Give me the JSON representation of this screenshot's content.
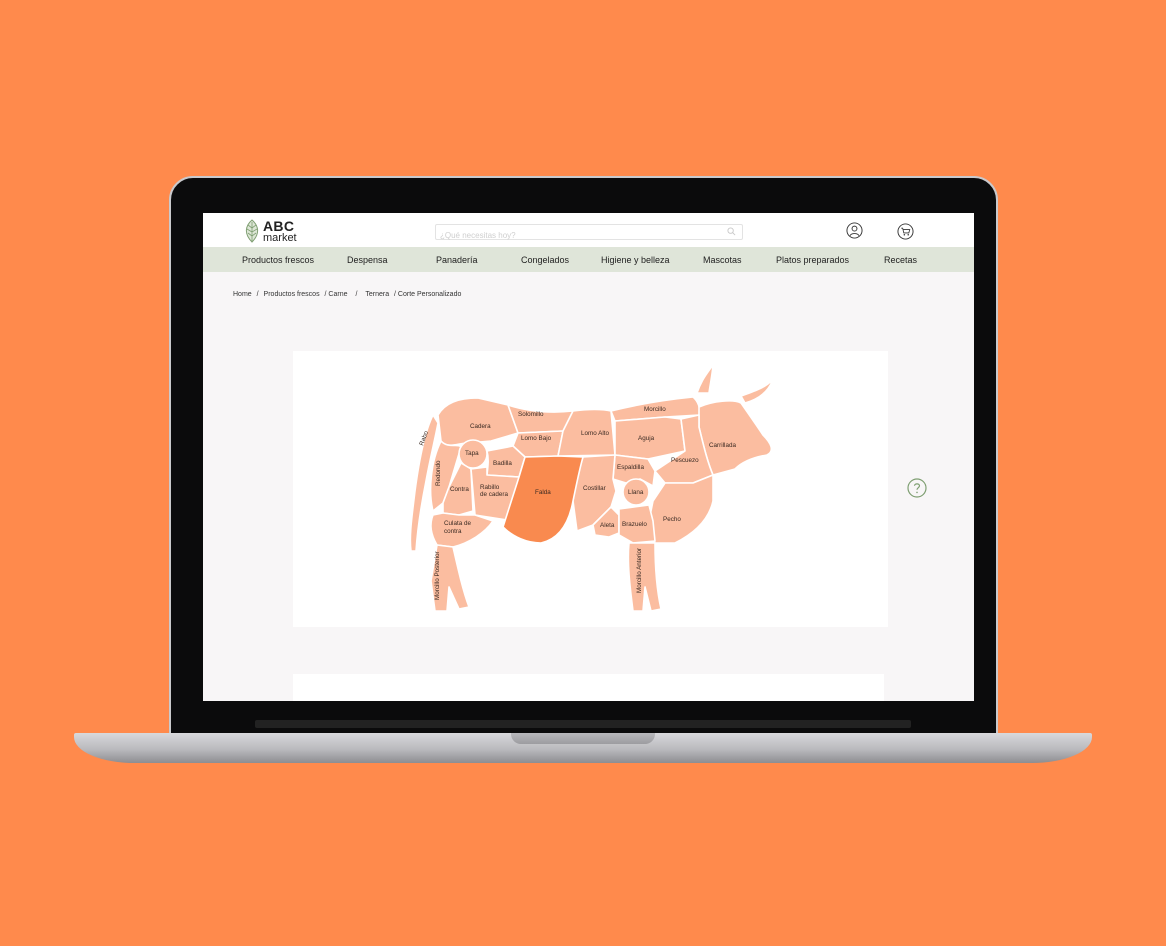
{
  "header": {
    "logo_primary": "ABC",
    "logo_secondary": "market",
    "search_placeholder": "¿Qué necesitas hoy?"
  },
  "nav": {
    "items": [
      {
        "label": "Productos frescos"
      },
      {
        "label": "Despensa"
      },
      {
        "label": "Panadería"
      },
      {
        "label": "Congelados"
      },
      {
        "label": "Higiene y belleza"
      },
      {
        "label": "Mascotas"
      },
      {
        "label": "Platos preparados"
      },
      {
        "label": "Recetas"
      }
    ]
  },
  "breadcrumb": {
    "items": [
      "Home",
      "/",
      "Productos frescos",
      "/ Carne",
      "/",
      "Ternera",
      "/ Corte Personalizado"
    ]
  },
  "cuts": {
    "rabo": "Rabo",
    "cadera": "Cadera",
    "solomillo": "Solomillo",
    "morcillo": "Morcillo",
    "lomo_bajo": "Lomo Bajo",
    "lomo_alto": "Lomo Alto",
    "aguja": "Aguja",
    "carrillada": "Carrillada",
    "redondo": "Redondo",
    "tapa": "Tapa",
    "badilla": "Badilla",
    "espaldilla": "Espaldilla",
    "pescuezo": "Pescuezo",
    "contra": "Contra",
    "rabillo_1": "Rabillo",
    "rabillo_2": "de cadera",
    "falda": "Falda",
    "costillar": "Costillar",
    "llana": "Llana",
    "pecho": "Pecho",
    "culata_1": "Culata de",
    "culata_2": "contra",
    "aleta": "Aleta",
    "brazuelo": "Brazuelo",
    "morcillo_posterior": "Morcillo Posterior",
    "morcillo_anterior": "Morcillo Anterior"
  },
  "selected_cut": "Falda",
  "colors": {
    "background": "#ff8a4c",
    "nav_bar": "#dfe5d9",
    "cut_fill": "#fbbda0",
    "cut_selected": "#f98a4f",
    "accent_green": "#7f9f72"
  },
  "icons": {
    "logo": "leaf-icon",
    "search": "search-icon",
    "user": "user-icon",
    "cart": "cart-icon",
    "help": "help-icon"
  }
}
